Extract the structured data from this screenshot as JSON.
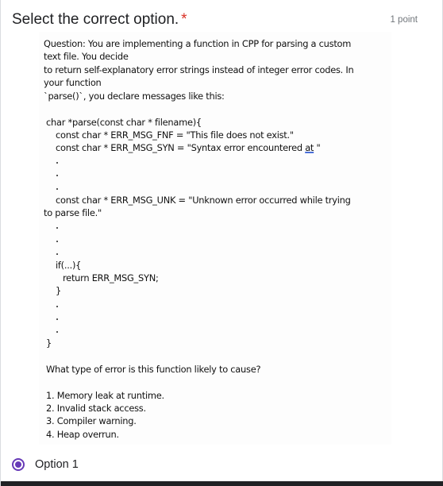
{
  "question": {
    "title": "Select the correct option.",
    "required_mark": "*",
    "points": "1 point"
  },
  "question_image": {
    "lines": [
      "Question: You are implementing a function in CPP for parsing a custom",
      "text file. You decide",
      " to return self-explanatory  error strings instead of integer error codes. In",
      "your function",
      " `parse()`, you declare messages like this:",
      "char *parse(const char * filename){",
      "const char * ERR_MSG_FNF = \"This file does not exist.\"",
      "const char * ERR_MSG_SYN = \"Syntax error encountered ",
      "const char * ERR_MSG_UNK = \"Unknown error occurred while trying",
      "to parse file.\"",
      "if(...){",
      "return ERR_MSG_SYN;",
      "}",
      "}",
      "What type of error is this function likely to cause?",
      "1. Memory leak at runtime.",
      "2. Invalid stack access.",
      "3. Compiler warning.",
      "4. Heap overrun."
    ],
    "at_word": "at",
    "syn_tail": " \""
  },
  "options": [
    {
      "label": "Option 1",
      "selected": true
    }
  ],
  "colors": {
    "accent": "#673ab7",
    "required": "#d93025"
  }
}
